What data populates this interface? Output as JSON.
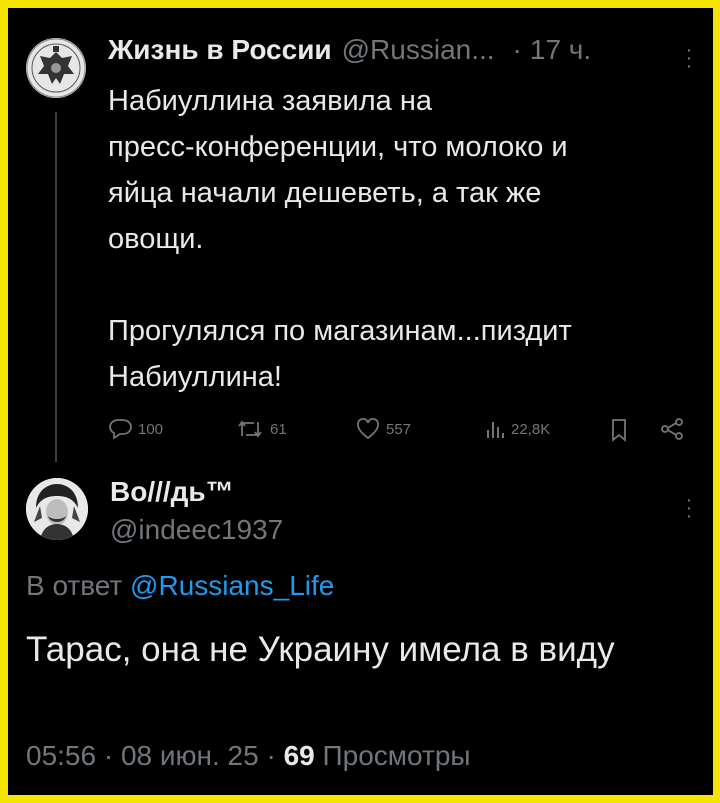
{
  "tweet1": {
    "author_name": "Жизнь в России",
    "handle": "@Russian...",
    "time": "17 ч.",
    "body": "Набиуллина заявила на\nпресс-конференции, что молоко и\nяйца начали дешеветь, а так же\nовощи.\n\nПрогулялся по магазинам...пиздит\nНабиуллина!",
    "replies": "100",
    "reposts": "61",
    "likes": "557",
    "views": "22,8K"
  },
  "tweet2": {
    "author_name": "Во///дь™",
    "handle": "@indeec1937",
    "reply_prefix": "В ответ",
    "reply_to": "@Russians_Life",
    "body": "Тарас, она не Украину имела в виду",
    "time": "05:56 · 08 июн. 25 ·",
    "views_count": "69",
    "views_label": "Просмотры"
  },
  "colors": {
    "background": "#000000",
    "border": "#f4e400",
    "text": "#e7e9ea",
    "muted": "#71767b",
    "link": "#1d9bf0"
  },
  "icons": [
    "reply-icon",
    "repost-icon",
    "like-icon",
    "views-icon",
    "bookmark-icon",
    "share-icon",
    "more-icon"
  ]
}
